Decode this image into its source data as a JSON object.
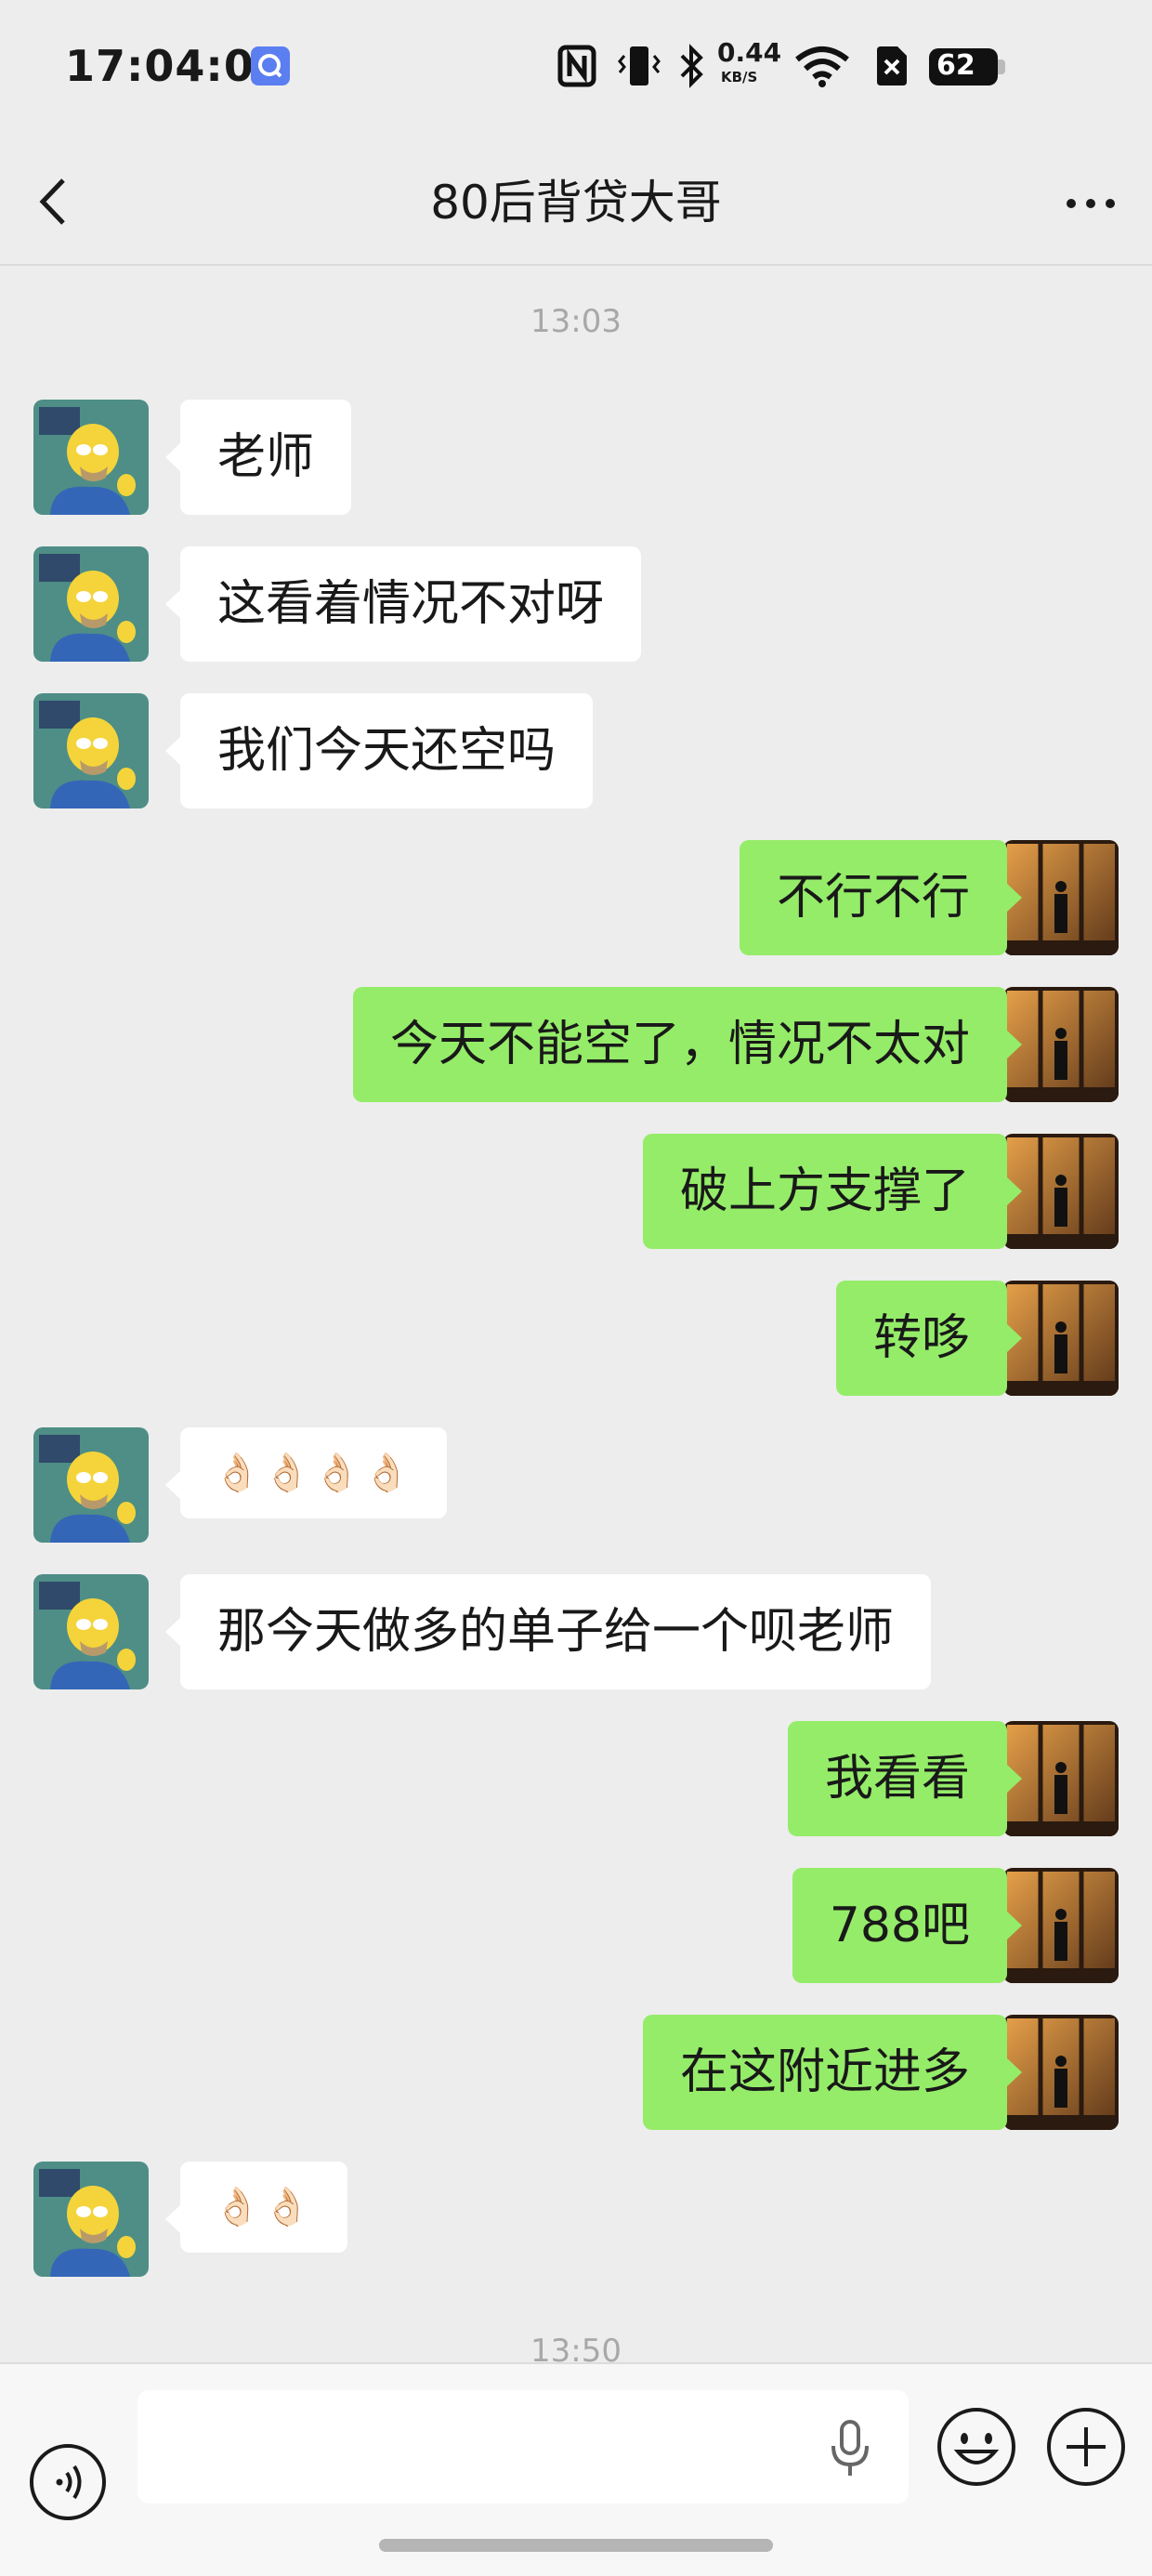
{
  "status_bar": {
    "time": "17:04:05",
    "network_speed": "0.44",
    "network_unit": "KB/S",
    "battery": "62",
    "icons": [
      "nfc-icon",
      "vibrate-icon",
      "bluetooth-icon",
      "wifi-icon",
      "sim-error-icon",
      "battery-icon"
    ]
  },
  "header": {
    "title": "80后背贷大哥"
  },
  "messages": [
    {
      "type": "time",
      "text": "13:03"
    },
    {
      "side": "left",
      "text": "老师"
    },
    {
      "side": "left",
      "text": "这看着情况不对呀"
    },
    {
      "side": "left",
      "text": "我们今天还空吗"
    },
    {
      "side": "right",
      "text": "不行不行"
    },
    {
      "side": "right",
      "text": "今天不能空了，情况不太对"
    },
    {
      "side": "right",
      "text": "破上方支撑了"
    },
    {
      "side": "right",
      "text": "转哆"
    },
    {
      "side": "left",
      "text": "👌🏻👌🏻👌🏻👌🏻",
      "emoji": true
    },
    {
      "side": "left",
      "text": "那今天做多的单子给一个呗老师"
    },
    {
      "side": "right",
      "text": "我看看"
    },
    {
      "side": "right",
      "text": "788吧"
    },
    {
      "side": "right",
      "text": "在这附近进多"
    },
    {
      "side": "left",
      "text": "👌🏻👌🏻",
      "emoji": true
    },
    {
      "type": "time",
      "text": "13:50"
    }
  ],
  "input_bar": {
    "placeholder": "",
    "icons": [
      "voice-icon",
      "microphone-icon",
      "emoji-icon",
      "plus-icon"
    ]
  },
  "colors": {
    "background": "#ededed",
    "outgoing_bubble": "#95ec69",
    "incoming_bubble": "#ffffff"
  }
}
